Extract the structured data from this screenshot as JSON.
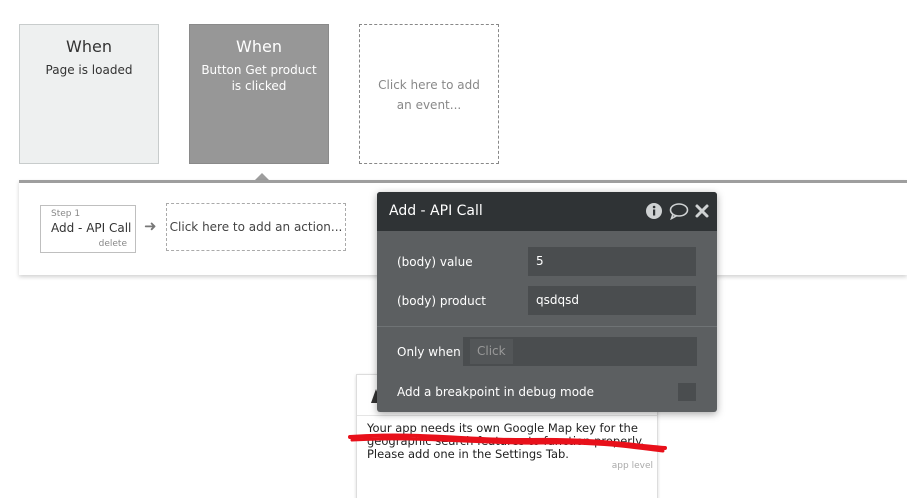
{
  "events": [
    {
      "when": "When",
      "desc": "Page is loaded"
    },
    {
      "when": "When",
      "desc": "Button Get product is clicked"
    },
    {
      "add_label": "Click here to add an event..."
    }
  ],
  "workflow": {
    "step_number": "Step 1",
    "step_name": "Add - API Call",
    "delete_label": "delete",
    "add_action_label": "Click here to add an action..."
  },
  "dialog": {
    "title": "Add - API Call",
    "icons": [
      "info-icon",
      "comment-icon",
      "close-icon"
    ],
    "fields": [
      {
        "label": "(body) value",
        "value": "5"
      },
      {
        "label": "(body) product",
        "value": "qsdqsd"
      }
    ],
    "only_when_label": "Only when",
    "only_when_placeholder": "Click",
    "breakpoint_label": "Add a breakpoint in debug mode"
  },
  "issue": {
    "message": "Your app needs its own Google Map key for the geographic search features to function properly. Please add one in the Settings Tab.",
    "level": "app level"
  },
  "colors": {
    "dialog_bg": "#5c5f61",
    "dialog_title_bg": "#2f3335",
    "selected_event_bg": "#979797",
    "annotation_red": "#e8101a"
  }
}
